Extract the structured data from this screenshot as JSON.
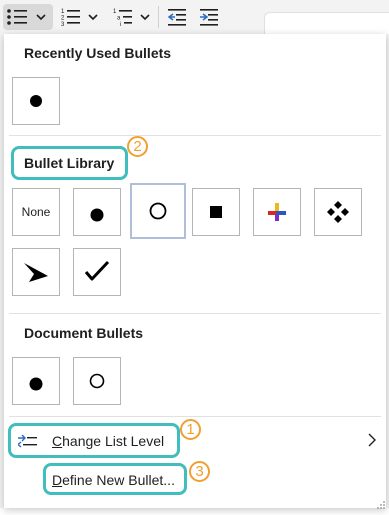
{
  "toolbar": {
    "bullets_button": "bullets",
    "numbering_button": "numbering",
    "multilevel_button": "multilevel-list",
    "decrease_indent": "decrease-indent",
    "increase_indent": "increase-indent"
  },
  "recently_used": {
    "title": "Recently Used Bullets",
    "items": [
      "filled-circle"
    ]
  },
  "library": {
    "title": "Bullet Library",
    "items": [
      {
        "kind": "none",
        "label": "None"
      },
      {
        "kind": "filled-circle"
      },
      {
        "kind": "hollow-circle",
        "selected": true
      },
      {
        "kind": "filled-square"
      },
      {
        "kind": "color-cross"
      },
      {
        "kind": "diamond-cluster"
      },
      {
        "kind": "arrowhead"
      },
      {
        "kind": "checkmark"
      }
    ]
  },
  "document_bullets": {
    "title": "Document Bullets",
    "items": [
      "filled-circle",
      "hollow-circle"
    ]
  },
  "menu": {
    "change_list_level": "Change List Level",
    "define_new_bullet": "Define New Bullet..."
  },
  "annotations": {
    "badge_1": "1",
    "badge_2": "2",
    "badge_3": "3",
    "highlight_color": "#41bdbd",
    "badge_color": "#f0a030"
  }
}
